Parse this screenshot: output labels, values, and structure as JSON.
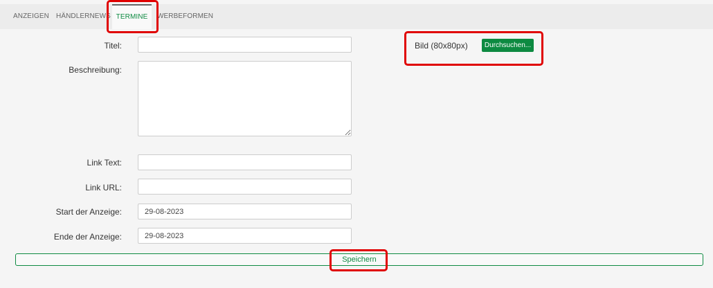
{
  "nav": {
    "tabs": [
      {
        "label": "ANZEIGEN"
      },
      {
        "label": "HÄNDLERNEWS"
      },
      {
        "label": "TERMINE"
      },
      {
        "label": "WERBEFORMEN"
      }
    ]
  },
  "form": {
    "titel_label": "Titel:",
    "titel_value": "",
    "beschreibung_label": "Beschreibung:",
    "beschreibung_value": "",
    "link_text_label": "Link Text:",
    "link_text_value": "",
    "link_url_label": "Link URL:",
    "link_url_value": "",
    "start_label": "Start der Anzeige:",
    "start_value": "29-08-2023",
    "ende_label": "Ende der Anzeige:",
    "ende_value": "29-08-2023",
    "bild_label": "Bild (80x80px)",
    "browse_label": "Durchsuchen...",
    "save_label": "Speichern"
  },
  "colors": {
    "accent": "#0d8a41",
    "highlight": "#e00000"
  }
}
